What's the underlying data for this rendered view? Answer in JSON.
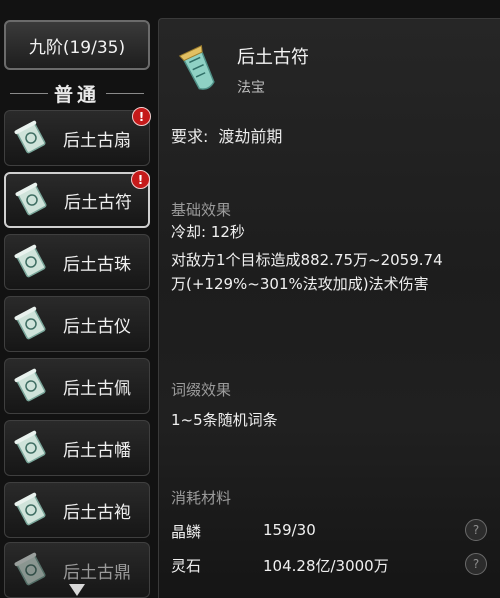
{
  "tier_button": {
    "label": "九阶(19/35)"
  },
  "section": {
    "title": "普通"
  },
  "items": [
    {
      "label": "后土古扇",
      "alert": "!"
    },
    {
      "label": "后土古符",
      "alert": "!"
    },
    {
      "label": "后土古珠"
    },
    {
      "label": "后土古仪"
    },
    {
      "label": "后土古佩"
    },
    {
      "label": "后土古幡"
    },
    {
      "label": "后土古袍"
    },
    {
      "label": "后土古鼎"
    }
  ],
  "detail": {
    "name": "后土古符",
    "type": "法宝",
    "requirement_label": "要求:",
    "requirement_value": "渡劫前期",
    "base_title": "基础效果",
    "cooldown": "冷却: 12秒",
    "effect_line1": "对敌方1个目标造成882.75万~2059.74",
    "effect_line2": "万(+129%~301%法攻加成)法术伤害",
    "affix_title": "词缀效果",
    "affix_text": "1~5条随机词条",
    "materials_title": "消耗材料",
    "materials": [
      {
        "name": "晶鳞",
        "amount": "159/30",
        "help": "?"
      },
      {
        "name": "灵石",
        "amount": "104.28亿/3000万",
        "help": "?"
      }
    ]
  },
  "colors": {
    "alert": "#c51a1a",
    "selected_border": "#cfcfcf",
    "muted_text": "#9b9b9b"
  }
}
